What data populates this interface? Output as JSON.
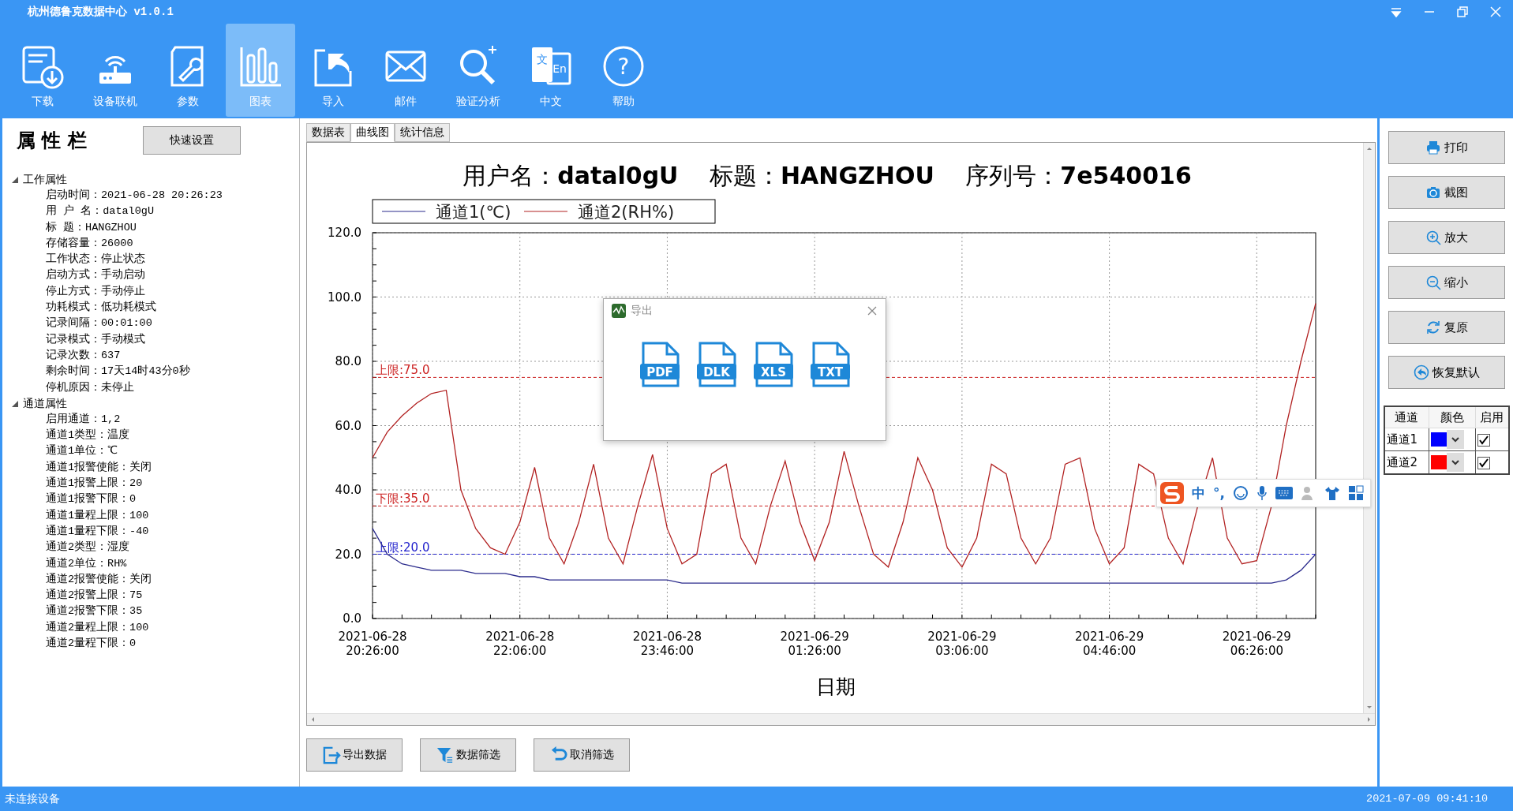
{
  "window": {
    "title": "杭州德鲁克数据中心 v1.0.1"
  },
  "toolbar": [
    {
      "label": "下载",
      "selected": false
    },
    {
      "label": "设备联机",
      "selected": false
    },
    {
      "label": "参数",
      "selected": false
    },
    {
      "label": "图表",
      "selected": true
    },
    {
      "label": "导入",
      "selected": false
    },
    {
      "label": "邮件",
      "selected": false
    },
    {
      "label": "验证分析",
      "selected": false
    },
    {
      "label": "中文",
      "selected": false,
      "icon_labels": [
        "文",
        "En"
      ]
    },
    {
      "label": "帮助",
      "selected": false,
      "icon_labels": [
        "?"
      ]
    }
  ],
  "properties": {
    "title": "属 性 栏",
    "quick_button": "快速设置",
    "groups": [
      {
        "label": "工作属性",
        "expanded": true,
        "children": [
          "启动时间：2021-06-28 20:26:23",
          "用 户 名：datal0gU",
          "标 题：HANGZHOU",
          "存储容量：26000",
          "工作状态：停止状态",
          "启动方式：手动启动",
          "停止方式：手动停止",
          "功耗模式：低功耗模式",
          "记录间隔：00:01:00",
          "记录模式：手动模式",
          "记录次数：637",
          "剩余时间：17天14时43分0秒",
          "停机原因：未停止"
        ]
      },
      {
        "label": "通道属性",
        "expanded": true,
        "children": [
          "启用通道：1,2",
          "通道1类型：温度",
          "通道1单位：℃",
          "通道1报警使能：关闭",
          "通道1报警上限：20",
          "通道1报警下限：0",
          "通道1量程上限：100",
          "通道1量程下限：-40",
          "通道2类型：湿度",
          "通道2单位：RH%",
          "通道2报警使能：关闭",
          "通道2报警上限：75",
          "通道2报警下限：35",
          "通道2量程上限：100",
          "通道2量程下限：0"
        ]
      }
    ]
  },
  "tabs": [
    {
      "label": "数据表",
      "selected": false
    },
    {
      "label": "曲线图",
      "selected": true
    },
    {
      "label": "统计信息",
      "selected": false
    }
  ],
  "chart": {
    "heading": "用户名：**datal0gU**　 标题：**HANGZHOU**　 序列号：**7e540016**",
    "chart_data": {
      "type": "line",
      "xlabel": "日期",
      "categories": [
        "2021-06-28 20:26:00",
        null,
        null,
        null,
        null,
        null,
        null,
        null,
        null,
        null,
        "2021-06-28 22:06:00",
        null,
        null,
        null,
        null,
        null,
        null,
        null,
        null,
        null,
        "2021-06-28 23:46:00",
        null,
        null,
        null,
        null,
        null,
        null,
        null,
        null,
        null,
        "2021-06-29 01:26:00",
        null,
        null,
        null,
        null,
        null,
        null,
        null,
        null,
        null,
        "2021-06-29 03:06:00",
        null,
        null,
        null,
        null,
        null,
        null,
        null,
        null,
        null,
        "2021-06-29 04:46:00",
        null,
        null,
        null,
        null,
        null,
        null,
        null,
        null,
        null,
        "2021-06-29 06:26:00",
        null,
        null,
        null,
        null
      ],
      "series": [
        {
          "name": "通道1(℃)",
          "color": "#2b2b8c",
          "values": [
            28,
            20,
            17,
            16,
            15,
            15,
            15,
            14,
            14,
            14,
            13,
            13,
            12,
            12,
            12,
            12,
            12,
            12,
            12,
            12,
            12,
            11,
            11,
            11,
            11,
            11,
            11,
            11,
            11,
            11,
            11,
            11,
            11,
            11,
            11,
            11,
            11,
            11,
            11,
            11,
            11,
            11,
            11,
            11,
            11,
            11,
            11,
            11,
            11,
            11,
            11,
            11,
            11,
            11,
            11,
            11,
            11,
            11,
            11,
            11,
            11,
            11,
            12,
            15,
            20
          ]
        },
        {
          "name": "通道2(RH%)",
          "color": "#b22222",
          "values": [
            50,
            58,
            63,
            67,
            70,
            71,
            40,
            28,
            22,
            20,
            30,
            47,
            25,
            17,
            30,
            48,
            25,
            17,
            35,
            51,
            28,
            17,
            20,
            45,
            48,
            25,
            17,
            35,
            49,
            30,
            18,
            30,
            52,
            35,
            20,
            16,
            30,
            50,
            40,
            22,
            16,
            25,
            48,
            45,
            25,
            17,
            25,
            48,
            50,
            28,
            17,
            22,
            48,
            45,
            25,
            17,
            35,
            50,
            25,
            17,
            18,
            35,
            60,
            80,
            98
          ]
        }
      ],
      "ylim": [
        0,
        120
      ],
      "yticks": [
        {
          "value": 0,
          "label": "0.0"
        },
        {
          "value": 20,
          "label": "20.0"
        },
        {
          "value": 40,
          "label": "40.0"
        },
        {
          "value": 60,
          "label": "60.0"
        },
        {
          "value": 80,
          "label": "80.0"
        },
        {
          "value": 100,
          "label": "100.0"
        },
        {
          "value": 120,
          "label": "120.0"
        }
      ],
      "ref_lines": [
        {
          "axis": "y",
          "value": 75,
          "label": "上限:75.0",
          "color": "#cc2222"
        },
        {
          "axis": "y",
          "value": 35,
          "label": "下限:35.0",
          "color": "#cc2222"
        },
        {
          "axis": "y",
          "value": 20,
          "label": "上限:20.0",
          "color": "#2222cc"
        }
      ],
      "grid": true,
      "legend": "top"
    }
  },
  "export_dialog": {
    "title": "导出",
    "formats": [
      "PDF",
      "DLK",
      "XLS",
      "TXT"
    ]
  },
  "side_buttons": [
    "打印",
    "截图",
    "放大",
    "缩小",
    "复原",
    "恢复默认"
  ],
  "channel_table": {
    "columns": [
      "通道",
      "颜色",
      "启用"
    ],
    "rows": [
      {
        "name": "通道1",
        "color": "#0000ff",
        "enabled": true
      },
      {
        "name": "通道2",
        "color": "#ff0000",
        "enabled": true
      }
    ]
  },
  "ime_bar": {
    "items": [
      "中",
      "°,"
    ]
  },
  "bottom_buttons": [
    "导出数据",
    "数据筛选",
    "取消筛选"
  ],
  "status_bar": {
    "connection": "未连接设备",
    "time": "2021-07-09 09:41:10"
  }
}
